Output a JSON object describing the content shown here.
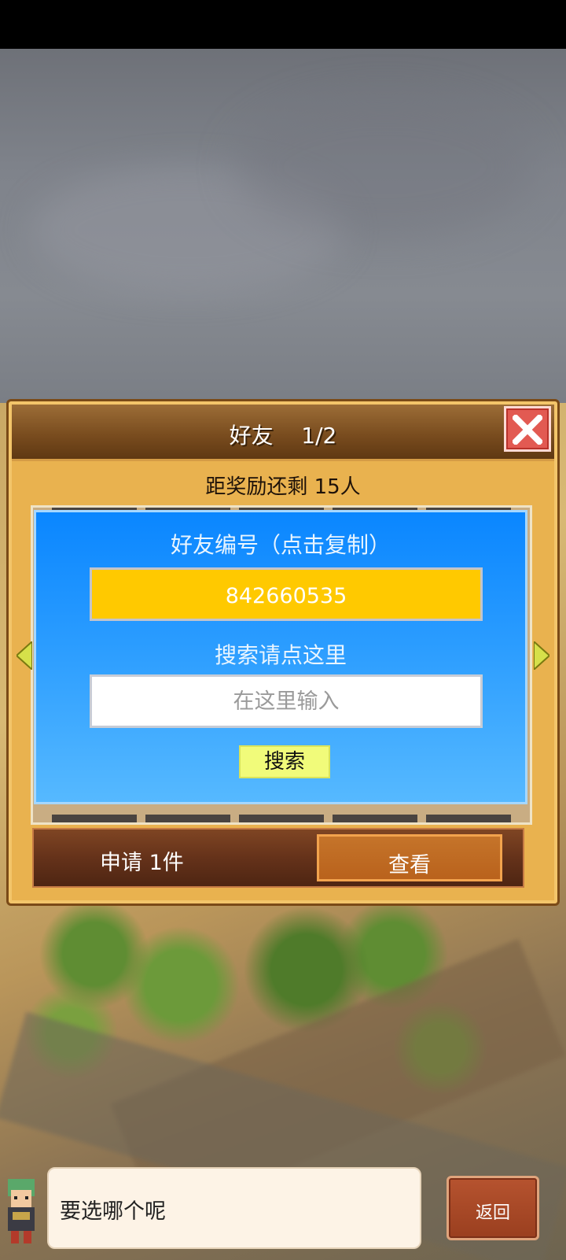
{
  "window": {
    "title": "好友",
    "page_indicator": "1/2"
  },
  "reward": {
    "text": "距奖励还剩 15人"
  },
  "friend_code": {
    "label": "好友编号（点击复制）",
    "value": "842660535"
  },
  "search": {
    "label": "搜索请点这里",
    "placeholder": "在这里输入",
    "button_label": "搜索"
  },
  "applications": {
    "text": "申请 1件",
    "view_label": "查看"
  },
  "dialog": {
    "message": "要选哪个呢",
    "back_label": "返回"
  },
  "colors": {
    "panel_bg": "#e9b24f",
    "header_bg": "#7a4d1f",
    "blue_panel": "#2a9cff",
    "id_box": "#ffc900",
    "search_button": "#f1fb7a",
    "close_button": "#e25a52",
    "view_button": "#c5742a",
    "back_button": "#b6532f"
  },
  "icons": [
    "close-icon",
    "arrow-left-icon",
    "arrow-right-icon",
    "character-avatar"
  ]
}
